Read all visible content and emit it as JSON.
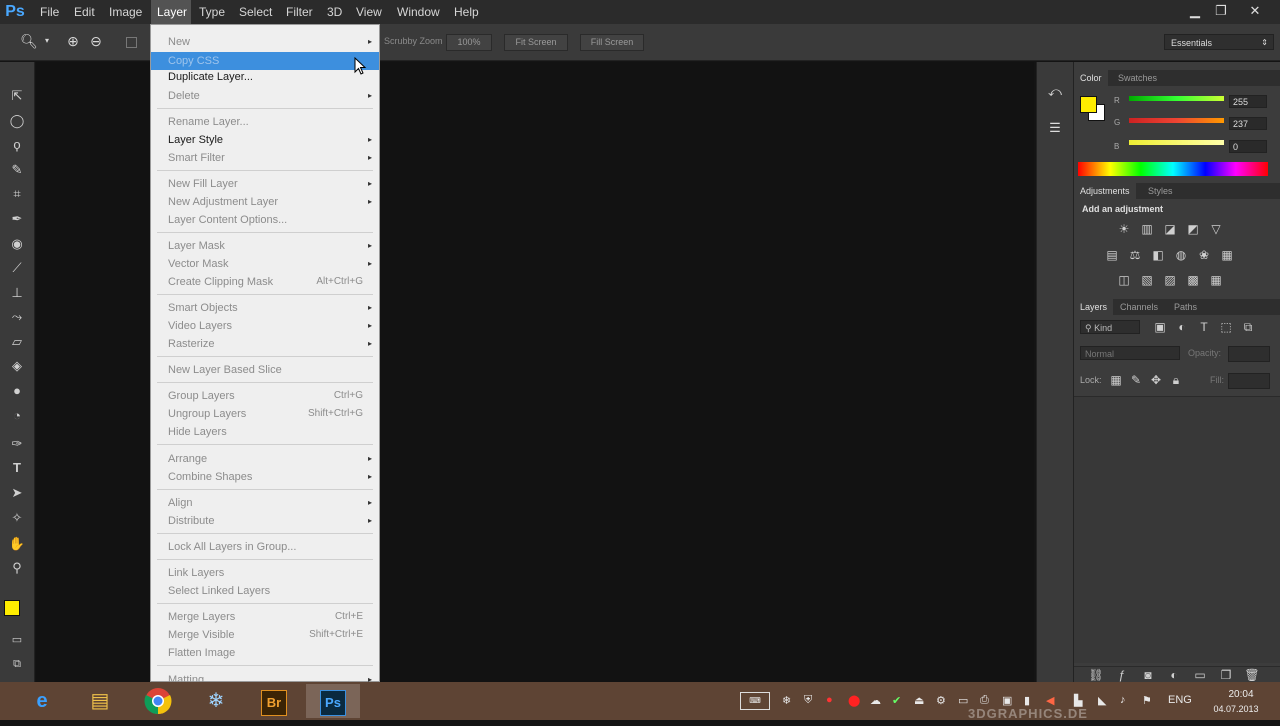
{
  "menubar": {
    "logo": "Ps",
    "items": [
      "File",
      "Edit",
      "Image",
      "Layer",
      "Type",
      "Select",
      "Filter",
      "3D",
      "View",
      "Window",
      "Help"
    ],
    "window_controls": {
      "minimize": "▁",
      "restore": "❐",
      "close": "✕"
    }
  },
  "options_bar": {
    "scrubby_zoom": "Scrubby Zoom",
    "btn_100": "100%",
    "btn_fit": "Fit Screen",
    "btn_fill": "Fill Screen",
    "workspace": "Essentials"
  },
  "layer_menu": {
    "items": [
      {
        "label": "New",
        "shortcut": "",
        "arrow": "▸"
      },
      {
        "label": "Copy CSS",
        "shortcut": "",
        "arrow": ""
      },
      {
        "label": "Duplicate Layer...",
        "shortcut": "",
        "arrow": ""
      },
      {
        "label": "Delete",
        "shortcut": "",
        "arrow": "▸"
      },
      {
        "label": "Rename Layer...",
        "shortcut": "",
        "arrow": ""
      },
      {
        "label": "Layer Style",
        "shortcut": "",
        "arrow": "▸"
      },
      {
        "label": "Smart Filter",
        "shortcut": "",
        "arrow": "▸"
      },
      {
        "label": "New Fill Layer",
        "shortcut": "",
        "arrow": "▸"
      },
      {
        "label": "New Adjustment Layer",
        "shortcut": "",
        "arrow": "▸"
      },
      {
        "label": "Layer Content Options...",
        "shortcut": "",
        "arrow": ""
      },
      {
        "label": "Layer Mask",
        "shortcut": "",
        "arrow": "▸"
      },
      {
        "label": "Vector Mask",
        "shortcut": "",
        "arrow": "▸"
      },
      {
        "label": "Create Clipping Mask",
        "shortcut": "Alt+Ctrl+G",
        "arrow": ""
      },
      {
        "label": "Smart Objects",
        "shortcut": "",
        "arrow": "▸"
      },
      {
        "label": "Video Layers",
        "shortcut": "",
        "arrow": "▸"
      },
      {
        "label": "Rasterize",
        "shortcut": "",
        "arrow": "▸"
      },
      {
        "label": "New Layer Based Slice",
        "shortcut": "",
        "arrow": ""
      },
      {
        "label": "Group Layers",
        "shortcut": "Ctrl+G",
        "arrow": ""
      },
      {
        "label": "Ungroup Layers",
        "shortcut": "Shift+Ctrl+G",
        "arrow": ""
      },
      {
        "label": "Hide Layers",
        "shortcut": "",
        "arrow": ""
      },
      {
        "label": "Arrange",
        "shortcut": "",
        "arrow": "▸"
      },
      {
        "label": "Combine Shapes",
        "shortcut": "",
        "arrow": "▸"
      },
      {
        "label": "Align",
        "shortcut": "",
        "arrow": "▸"
      },
      {
        "label": "Distribute",
        "shortcut": "",
        "arrow": "▸"
      },
      {
        "label": "Lock All Layers in Group...",
        "shortcut": "",
        "arrow": ""
      },
      {
        "label": "Link Layers",
        "shortcut": "",
        "arrow": ""
      },
      {
        "label": "Select Linked Layers",
        "shortcut": "",
        "arrow": ""
      },
      {
        "label": "Merge Layers",
        "shortcut": "Ctrl+E",
        "arrow": ""
      },
      {
        "label": "Merge Visible",
        "shortcut": "Shift+Ctrl+E",
        "arrow": ""
      },
      {
        "label": "Flatten Image",
        "shortcut": "",
        "arrow": ""
      },
      {
        "label": "Matting",
        "shortcut": "",
        "arrow": "▸"
      }
    ]
  },
  "color_panel": {
    "tabs": [
      "Color",
      "Swatches"
    ],
    "channels": [
      {
        "name": "R",
        "value": "255",
        "color": "#22cc22"
      },
      {
        "name": "G",
        "value": "237",
        "color": "#cc2a2a"
      },
      {
        "name": "B",
        "value": "0",
        "color": "#e8e83a"
      }
    ],
    "fg_color": "#ffed00"
  },
  "adjustments_panel": {
    "tabs": [
      "Adjustments",
      "Styles"
    ],
    "heading": "Add an adjustment"
  },
  "layers_panel": {
    "tabs": [
      "Layers",
      "Channels",
      "Paths"
    ],
    "kind": "Kind",
    "blend_mode": "Normal",
    "opacity_label": "Opacity:",
    "lock_label": "Lock:",
    "fill_label": "Fill:"
  },
  "taskbar": {
    "lang": "ENG",
    "time": "20:04",
    "date": "04.07.2013",
    "watermark": "3DGRAPHICS.DE"
  }
}
